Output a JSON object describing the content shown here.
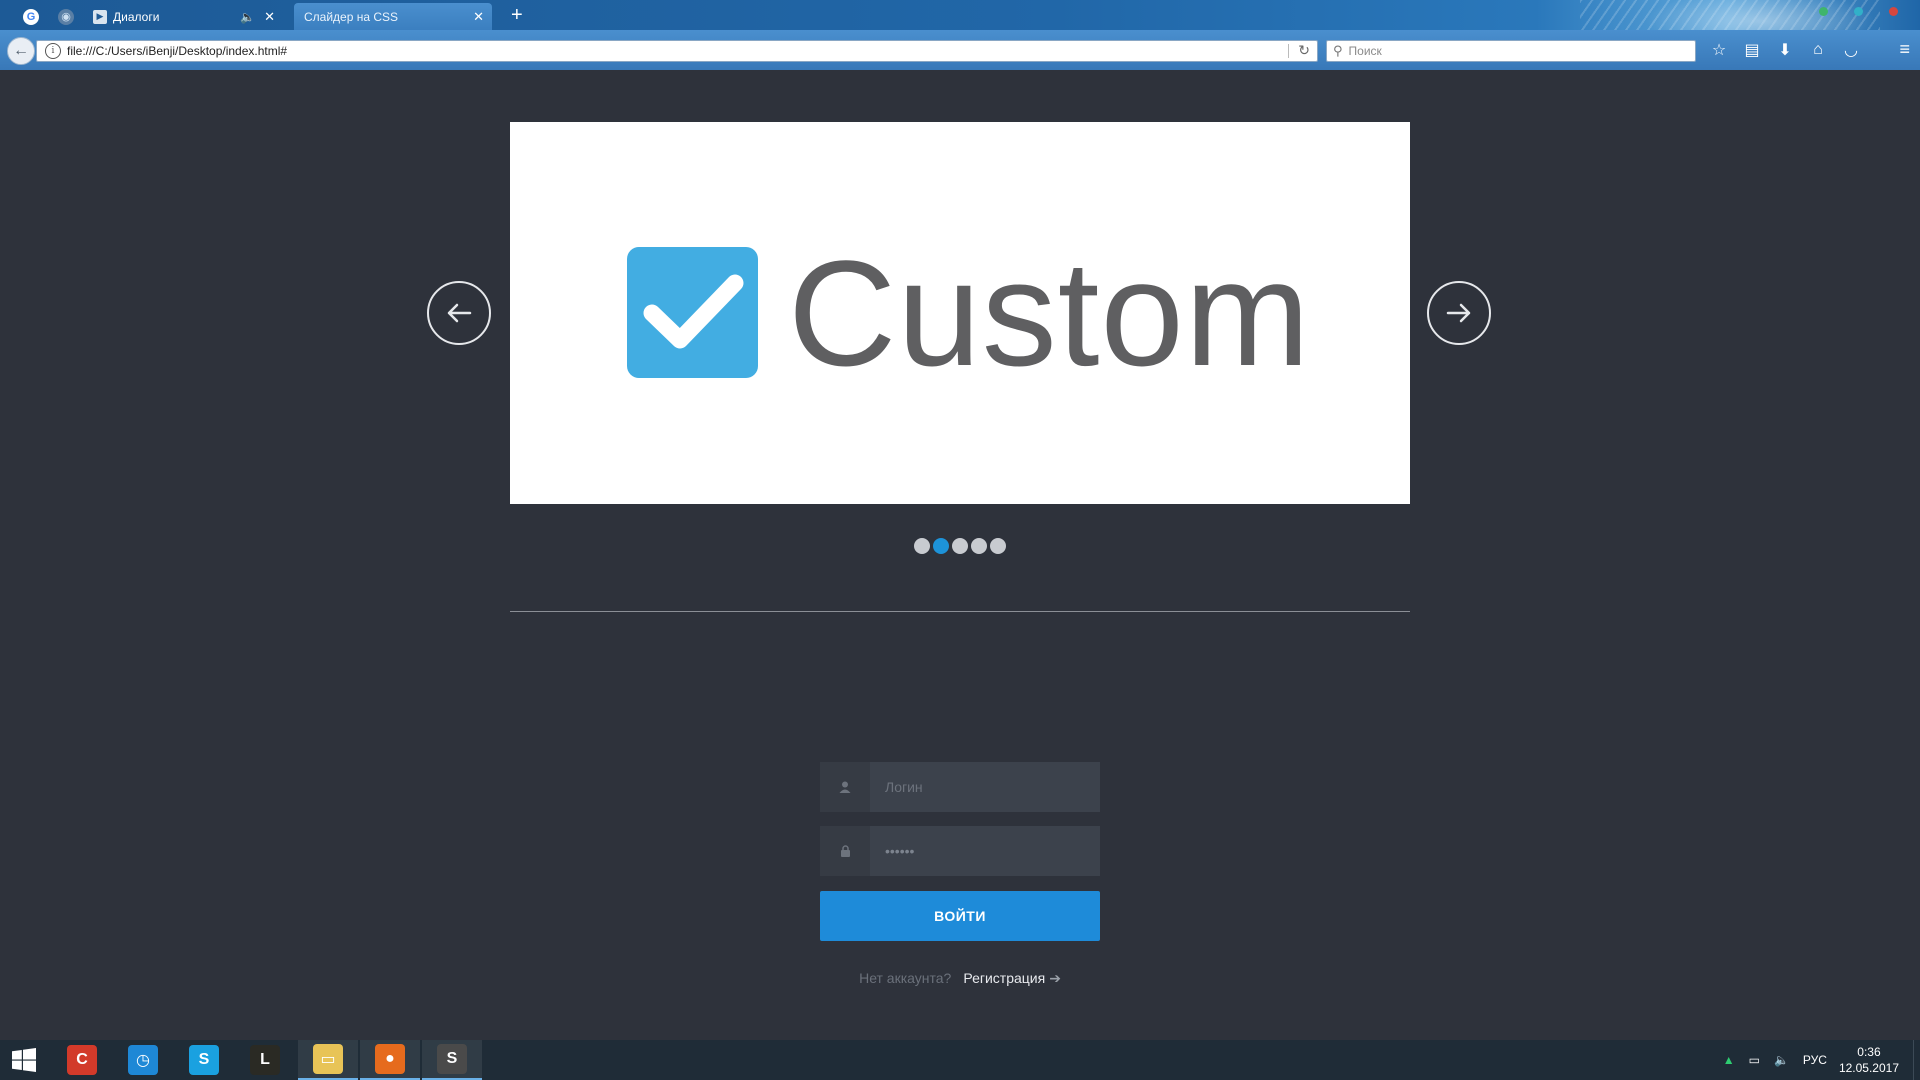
{
  "browser": {
    "tabs": [
      {
        "kind": "pinned",
        "icon": "google-icon",
        "glyph": "G"
      },
      {
        "kind": "pinned",
        "icon": "globe-icon",
        "glyph": "◉"
      },
      {
        "kind": "normal",
        "title": "Диалоги",
        "audio": true
      },
      {
        "kind": "active",
        "title": "Слайдер на CSS"
      }
    ],
    "url": "file:///C:/Users/iBenji/Desktop/index.html#",
    "search_placeholder": "Поиск"
  },
  "slider": {
    "logo_text": "Custom",
    "slide_count": 5,
    "active_slide_index": 1
  },
  "login_form": {
    "login_placeholder": "Логин",
    "password_value": "••••••",
    "submit_label": "ВОЙТИ",
    "no_account_text": "Нет аккаунта?",
    "register_link": "Регистрация",
    "register_arrow": "➔"
  },
  "taskbar": {
    "apps": [
      {
        "name": "ccleaner",
        "color": "#d23a2a",
        "glyph": "C"
      },
      {
        "name": "timer",
        "color": "#1e88d6",
        "glyph": "◷"
      },
      {
        "name": "skype",
        "color": "#1aa1e0",
        "glyph": "S"
      },
      {
        "name": "league-of-legends",
        "color": "#2a2a24",
        "glyph": "L"
      },
      {
        "name": "file-explorer",
        "color": "#e8c457",
        "glyph": "▭"
      },
      {
        "name": "firefox",
        "color": "#e66b1d",
        "glyph": "●"
      },
      {
        "name": "sublime-text",
        "color": "#4a4a4a",
        "glyph": "S"
      }
    ],
    "language": "РУС",
    "time": "0:36",
    "date": "12.05.2017"
  },
  "colors": {
    "page_bg": "#2e323b",
    "accent_blue": "#1e8bd9",
    "logo_blue": "#42ade2",
    "active_dot": "#1d93d9"
  }
}
